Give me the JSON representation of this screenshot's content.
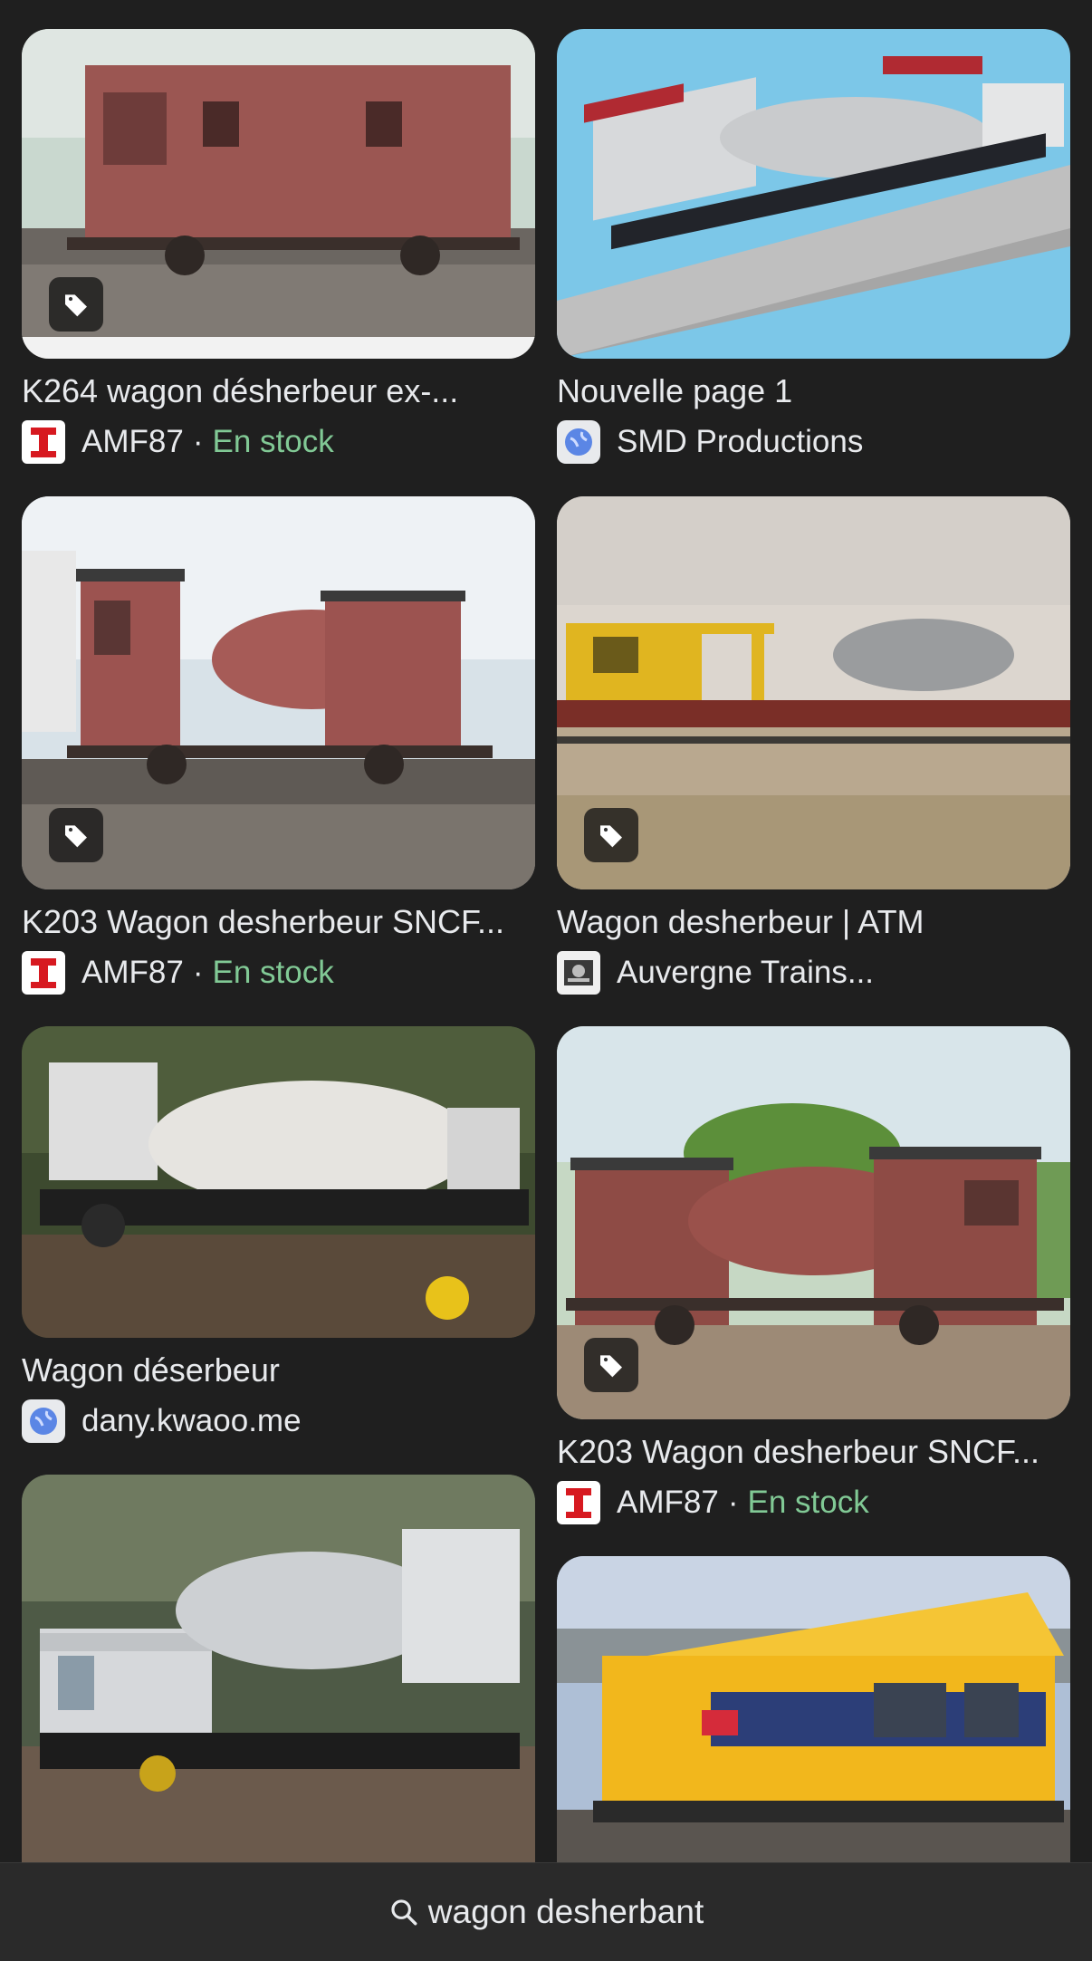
{
  "results": [
    {
      "title": "K264 wagon désherbeur ex-...",
      "source": "AMF87",
      "stock": "En stock",
      "favicon": "amf87-icon"
    },
    {
      "title": "Nouvelle page 1",
      "source": "SMD Productions",
      "stock": "",
      "favicon": "globe-icon"
    },
    {
      "title": "K203 Wagon desherbeur SNCF...",
      "source": "AMF87",
      "stock": "En stock",
      "favicon": "amf87-icon"
    },
    {
      "title": "Wagon desherbeur | ATM",
      "source": "Auvergne Trains...",
      "stock": "",
      "favicon": "atm-icon"
    },
    {
      "title": "Wagon déserbeur",
      "source": "dany.kwaoo.me",
      "stock": "",
      "favicon": "globe-icon"
    },
    {
      "title": "K203 Wagon desherbeur SNCF...",
      "source": "AMF87",
      "stock": "En stock",
      "favicon": "amf87-icon"
    }
  ],
  "separator": "·",
  "search": {
    "query": "wagon desherbant",
    "icon": "search-icon"
  },
  "colors": {
    "background": "#1f1f1f",
    "stock": "#81c995",
    "bar": "#2a2a2a"
  }
}
